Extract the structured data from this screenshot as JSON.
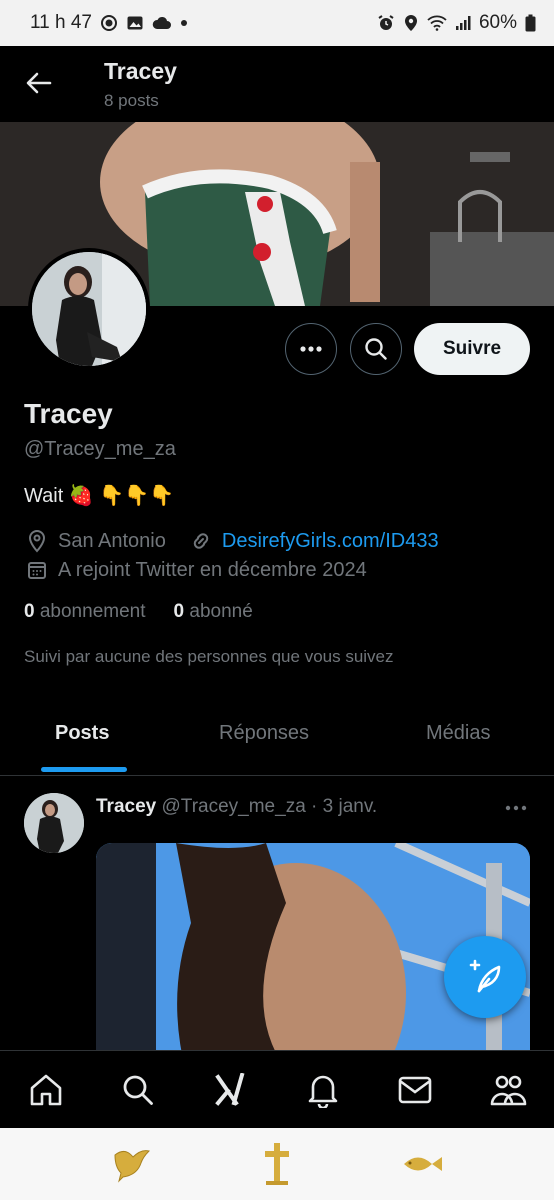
{
  "status_bar": {
    "time": "11 h 47",
    "battery": "60%"
  },
  "header": {
    "name": "Tracey",
    "post_count": "8 posts"
  },
  "profile": {
    "display_name": "Tracey",
    "handle": "@Tracey_me_za",
    "bio": "Wait 🍓 👇👇👇",
    "location": "San Antonio",
    "link": "DesirefyGirls.com/ID433",
    "joined": "A rejoint Twitter en décembre 2024",
    "following_count": "0",
    "following_label": "abonnement",
    "followers_count": "0",
    "followers_label": "abonné",
    "followed_by": "Suivi par aucune des personnes que vous suivez",
    "follow_button": "Suivre"
  },
  "tabs": [
    {
      "label": "Posts",
      "active": true
    },
    {
      "label": "Réponses",
      "active": false
    },
    {
      "label": "Médias",
      "active": false
    }
  ],
  "post": {
    "author": "Tracey",
    "handle_date": "@Tracey_me_za · 3 janv."
  },
  "colors": {
    "accent": "#1d9bf0",
    "background": "#000000",
    "muted_text": "#71767b"
  },
  "icons": {
    "nav": [
      "home-icon",
      "search-icon",
      "grok-icon",
      "notifications-icon",
      "messages-icon",
      "communities-icon"
    ],
    "system_nav": [
      "dove-icon",
      "cross-icon",
      "fish-icon"
    ]
  }
}
